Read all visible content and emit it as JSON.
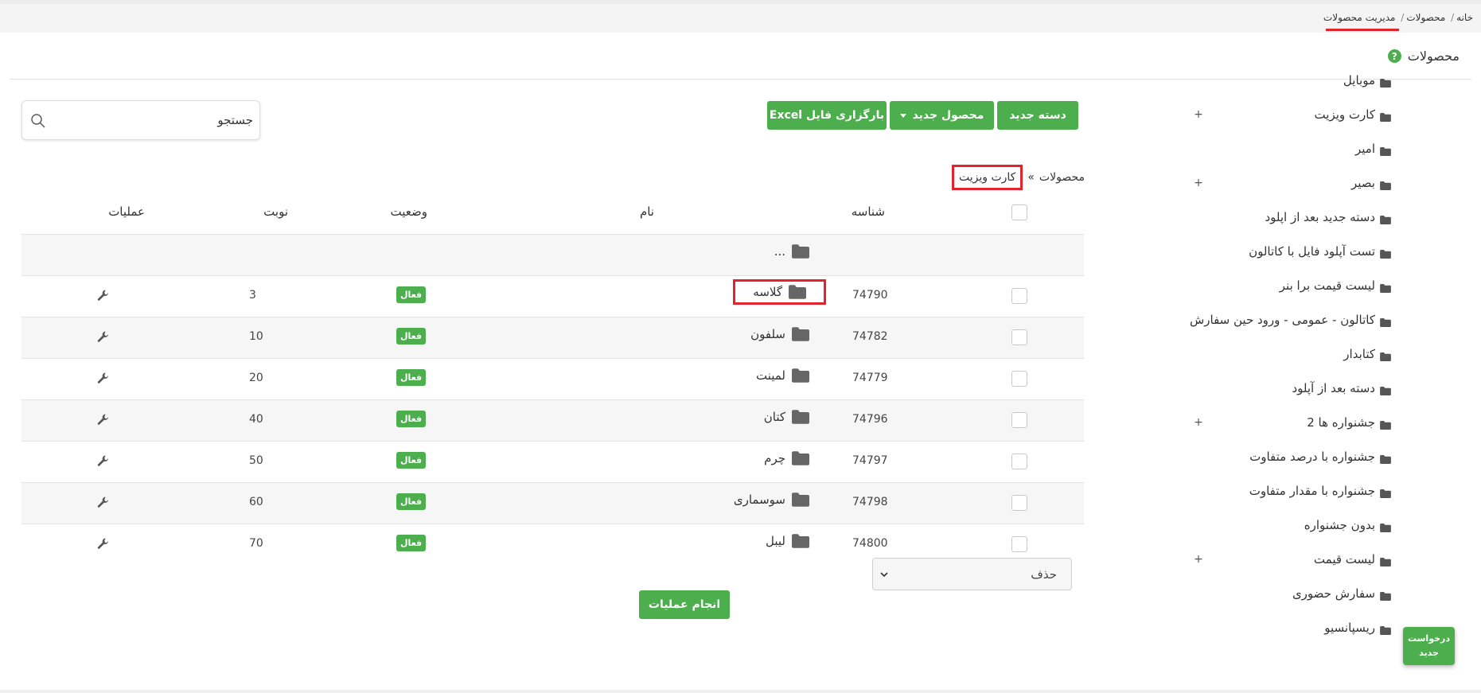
{
  "breadcrumb": {
    "home": "خانه",
    "products": "محصولات",
    "current": "مدیریت محصولات"
  },
  "page": {
    "title": "محصولات",
    "help": "?"
  },
  "colors": {
    "primary": "#4cae4c",
    "highlight": "#e3232c"
  },
  "toolbar": {
    "new_category": "دسته جدید",
    "new_product": "محصول جدید",
    "upload_excel": "بارگزاری فایل Excel",
    "search_placeholder": "جستجو"
  },
  "path": {
    "root": "محصولات",
    "sep": "»",
    "current": "کارت ویزیت"
  },
  "sidebar": {
    "items": [
      {
        "label": "موبایل"
      },
      {
        "label": "کارت ویزیت",
        "expandable": true
      },
      {
        "label": "امیر"
      },
      {
        "label": "بصیر",
        "expandable": true
      },
      {
        "label": "دسته جدید بعد از اپلود"
      },
      {
        "label": "تست آپلود فایل با کاتالون"
      },
      {
        "label": "لیست قیمت برا بنر"
      },
      {
        "label": "کاتالون - عمومی - ورود حین سفارش"
      },
      {
        "label": "کتابدار"
      },
      {
        "label": "دسته بعد از آپلود"
      },
      {
        "label": "جشنواره ها 2",
        "expandable": true
      },
      {
        "label": "جشنواره با درصد متفاوت"
      },
      {
        "label": "جشنواره با مقدار متفاوت"
      },
      {
        "label": "بدون جشنواره"
      },
      {
        "label": "لیست قیمت",
        "expandable": true
      },
      {
        "label": "سفارش حضوری"
      },
      {
        "label": "ریسپانسیو"
      }
    ],
    "plus": "+"
  },
  "table": {
    "headers": {
      "id": "شناسه",
      "name": "نام",
      "status": "وضعیت",
      "order": "نوبت",
      "ops": "عملیات"
    },
    "parent_label": "...",
    "rows": [
      {
        "id": "74790",
        "name": "گلاسه",
        "status": "فعال",
        "order": "3"
      },
      {
        "id": "74782",
        "name": "سلفون",
        "status": "فعال",
        "order": "10"
      },
      {
        "id": "74779",
        "name": "لمینت",
        "status": "فعال",
        "order": "20"
      },
      {
        "id": "74796",
        "name": "کتان",
        "status": "فعال",
        "order": "40"
      },
      {
        "id": "74797",
        "name": "چرم",
        "status": "فعال",
        "order": "50"
      },
      {
        "id": "74798",
        "name": "سوسماری",
        "status": "فعال",
        "order": "60"
      },
      {
        "id": "74800",
        "name": "لیبل",
        "status": "فعال",
        "order": "70"
      }
    ]
  },
  "bulk": {
    "action_selected": "حذف",
    "submit": "انجام عملیات"
  },
  "floating": {
    "new_request": "درخواست جدید"
  }
}
